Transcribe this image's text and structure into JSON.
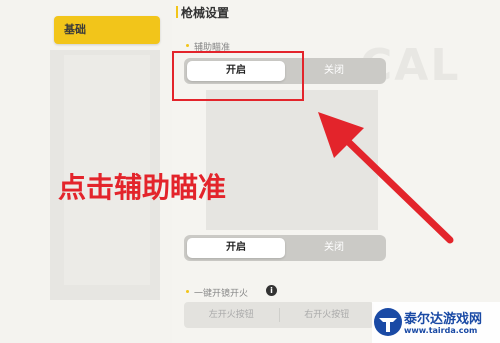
{
  "left_nav": {
    "active_category": "基础"
  },
  "section": {
    "title": "枪械设置"
  },
  "background": {
    "watermark": "CAL"
  },
  "aim_assist": {
    "label": "辅助瞄准",
    "options": [
      "开启",
      "关闭"
    ],
    "selected": "开启"
  },
  "second_toggle": {
    "options": [
      "开启",
      "关闭"
    ],
    "selected": "开启"
  },
  "quick_scope": {
    "label": "一键开镜开火",
    "info_icon": "i",
    "options": [
      "左开火按钮",
      "右开火按钮"
    ]
  },
  "annotation": {
    "text": "点击辅助瞄准",
    "color": "#e3242b"
  },
  "logo": {
    "name": "泰尔达游戏网",
    "site": "www.tairda.com",
    "mark_color": "#1a4aa5"
  }
}
